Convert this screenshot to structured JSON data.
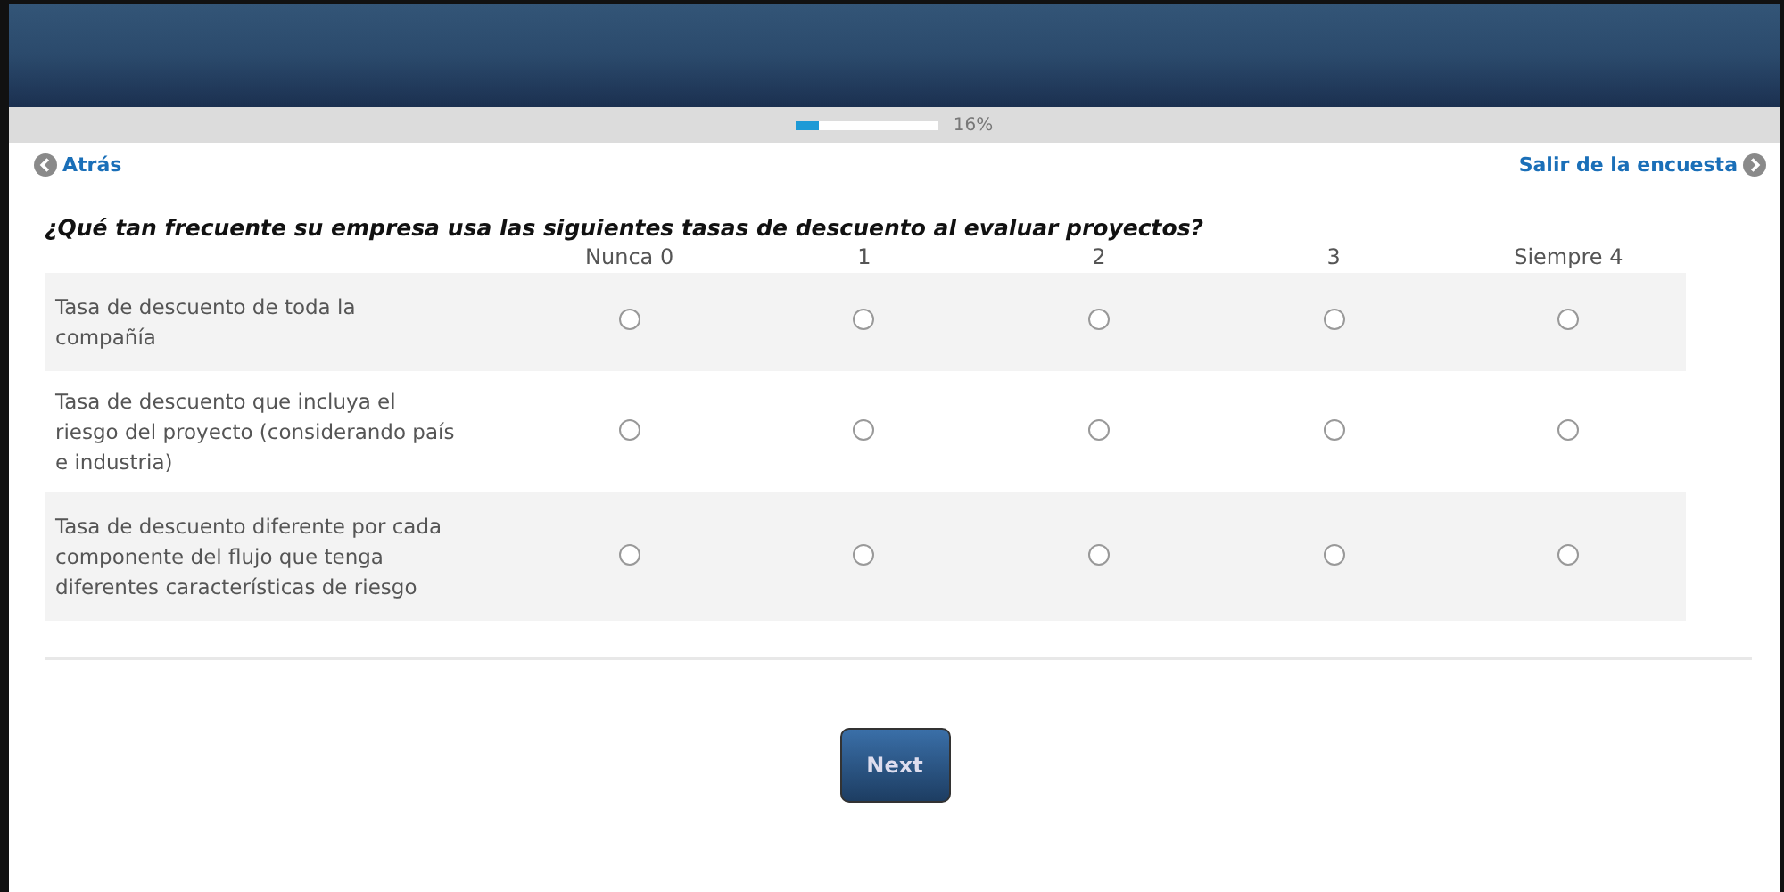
{
  "progress": {
    "level": 0.16,
    "label": "16%"
  },
  "nav": {
    "back": "Atrás",
    "exit": "Salir de la encuesta"
  },
  "question": "¿Qué tan frecuente su empresa usa las siguientes tasas de descuento al evaluar proyectos?",
  "scale": [
    "Nunca 0",
    "1",
    "2",
    "3",
    "Siempre 4"
  ],
  "rows": [
    {
      "label": "Tasa de descuento de toda la compañía",
      "choices": [
        {
          "selected": false
        },
        {
          "selected": false
        },
        {
          "selected": false
        },
        {
          "selected": false
        },
        {
          "selected": false
        }
      ]
    },
    {
      "label": "Tasa de descuento que incluya el riesgo del proyecto (considerando país e industria)",
      "choices": [
        {
          "selected": false
        },
        {
          "selected": false
        },
        {
          "selected": false
        },
        {
          "selected": false
        },
        {
          "selected": false
        }
      ]
    },
    {
      "label": "Tasa de descuento diferente por cada componente del flujo que tenga diferentes características de riesgo",
      "choices": [
        {
          "selected": false
        },
        {
          "selected": false
        },
        {
          "selected": false
        },
        {
          "selected": false
        },
        {
          "selected": false
        }
      ]
    }
  ],
  "next_button": "Next"
}
